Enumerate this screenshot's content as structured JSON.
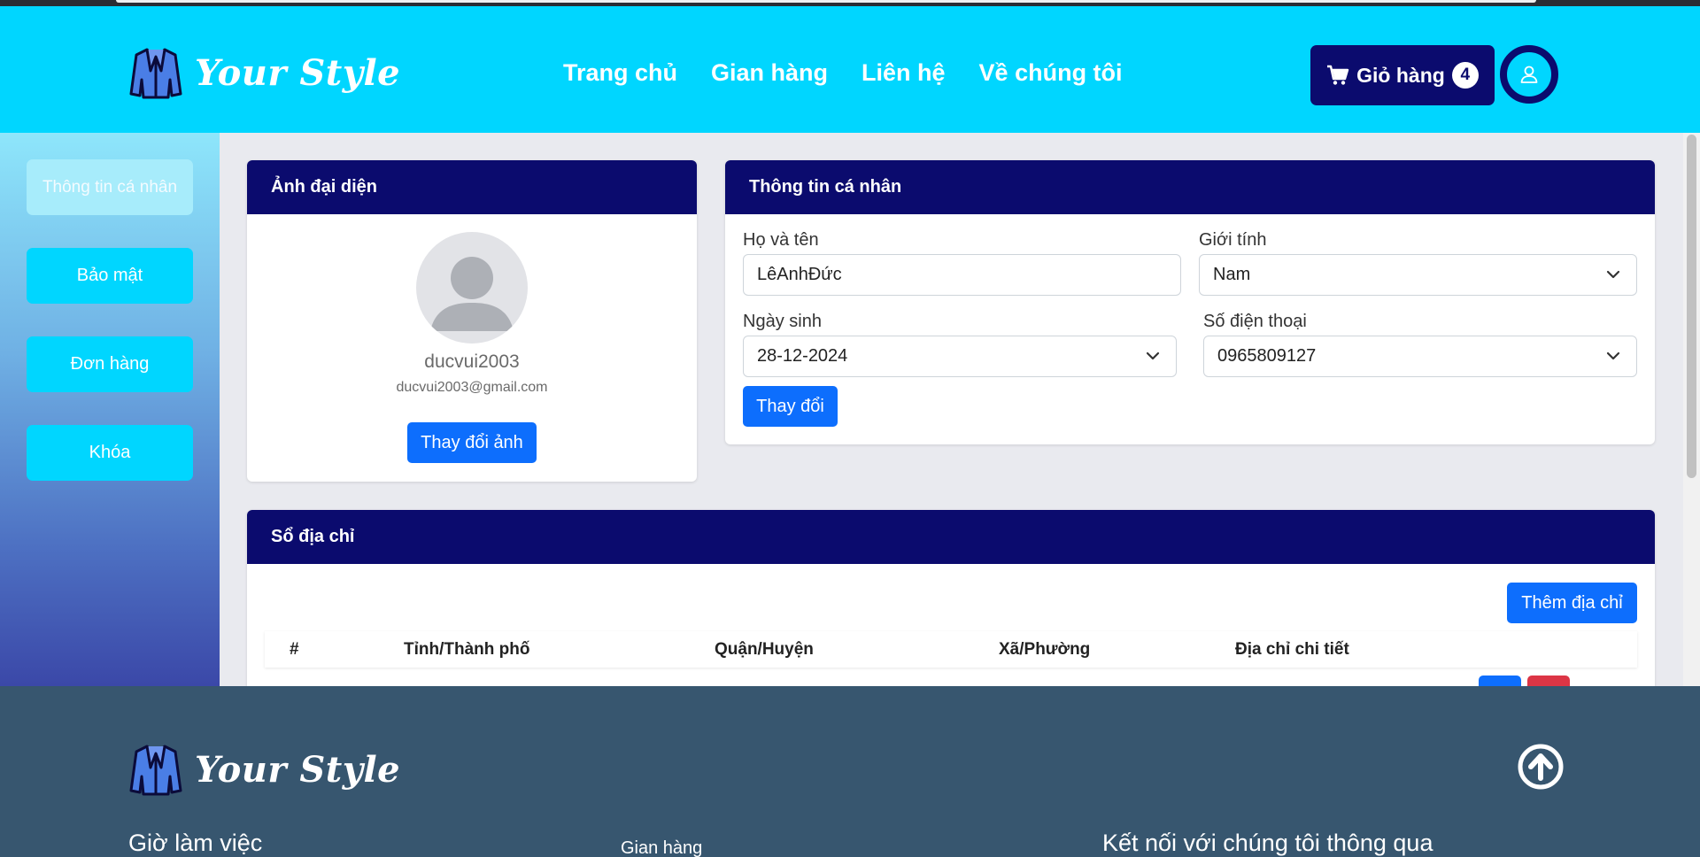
{
  "brand": {
    "name": "Your Style"
  },
  "nav": {
    "links": [
      "Trang chủ",
      "Gian hàng",
      "Liên hệ",
      "Về chúng tôi"
    ],
    "cart_label": "Giỏ hàng",
    "cart_count": "4"
  },
  "sidebar": {
    "items": [
      {
        "label": "Thông tin cá nhân",
        "active": true
      },
      {
        "label": "Bảo mật",
        "active": false
      },
      {
        "label": "Đơn hàng",
        "active": false
      },
      {
        "label": "Khóa",
        "active": false
      }
    ]
  },
  "avatar_card": {
    "title": "Ảnh đại diện",
    "username": "ducvui2003",
    "email": "ducvui2003@gmail.com",
    "change_button": "Thay đổi ảnh"
  },
  "info_card": {
    "title": "Thông tin cá nhân",
    "fullname_label": "Họ và tên",
    "fullname_value": "LêAnhĐức",
    "gender_label": "Giới tính",
    "gender_value": "Nam",
    "dob_label": "Ngày sinh",
    "dob_value": "28-12-2024",
    "phone_label": "Số điện thoại",
    "phone_value": "0965809127",
    "submit_button": "Thay đổi"
  },
  "address_card": {
    "title": "Sổ địa chỉ",
    "add_button": "Thêm địa chỉ",
    "columns": [
      "#",
      "Tỉnh/Thành phố",
      "Quận/Huyện",
      "Xã/Phường",
      "Địa chỉ chi tiết"
    ]
  },
  "footer": {
    "working_hours_heading": "Giờ làm việc",
    "shop_link": "Gian hàng",
    "connect_heading": "Kết nối với chúng tôi thông qua"
  },
  "colors": {
    "header_bg": "#00d6ff",
    "navy": "#0b0b6e",
    "primary": "#0d6efd",
    "danger": "#dc3545",
    "footer_bg": "#37566f"
  },
  "icons": {
    "logo": "jacket-icon",
    "cart": "cart-icon",
    "user": "user-icon",
    "avatar": "avatar-placeholder-icon",
    "select": "chevron-down-icon",
    "scroll_top": "arrow-up-circle-icon"
  }
}
